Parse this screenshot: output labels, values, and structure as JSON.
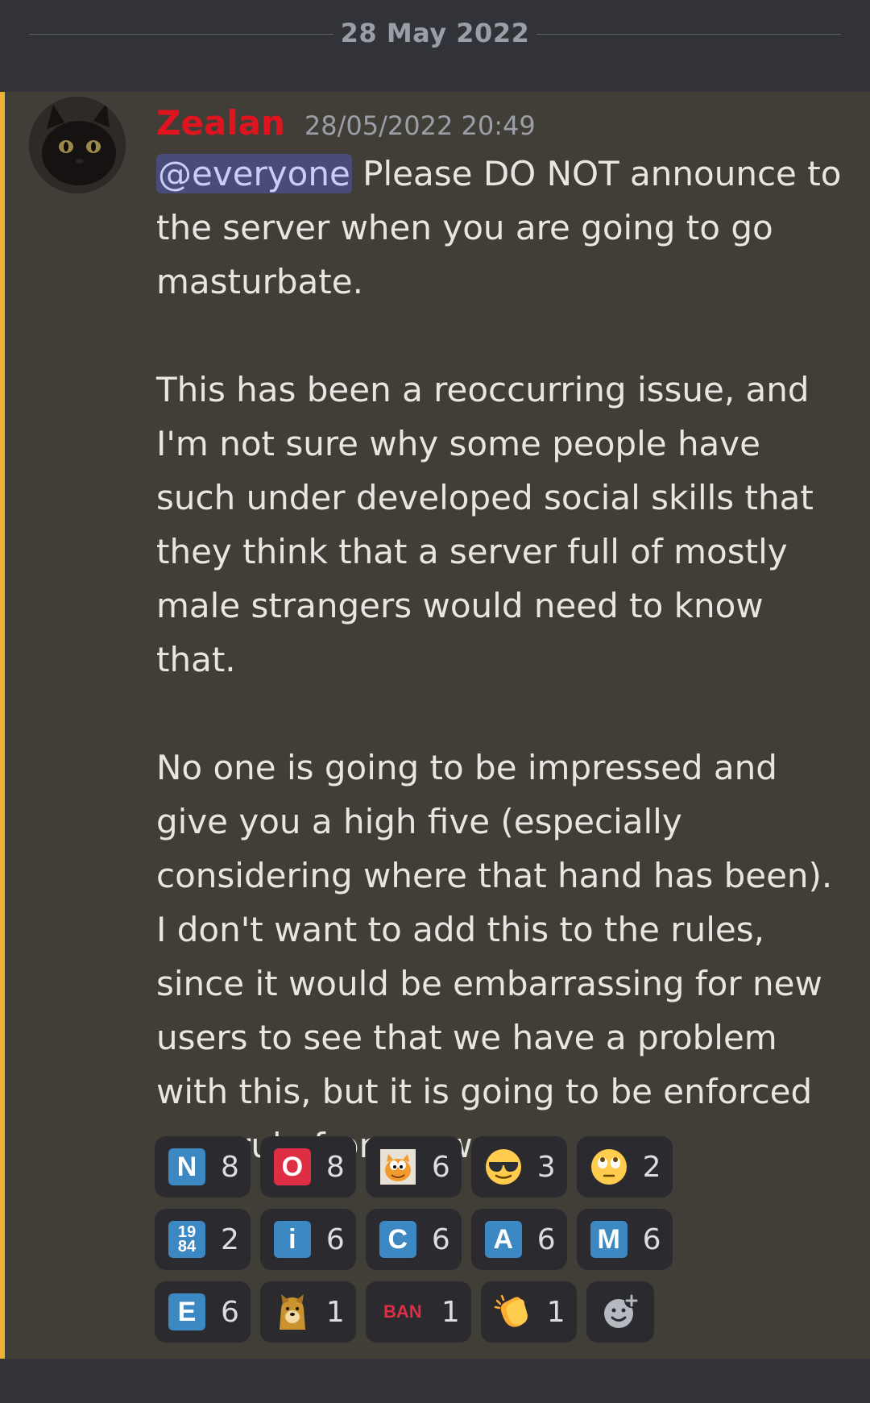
{
  "divider": {
    "date": "28 May 2022"
  },
  "message": {
    "username": "Zealan",
    "timestamp": "28/05/2022 20:49",
    "mention": "@everyone",
    "paragraph_1_rest": " Please DO NOT announce to the server when you are going to go masturbate.",
    "paragraph_2": "This has been a reoccurring issue, and I'm not sure why some people have such under developed social skills that they think that a server full of mostly male strangers would need to know that.",
    "paragraph_3": "No one is going to be impressed and give you a high five (especially considering where that hand has been). I don't want to add this to the rules, since it would be embarrassing for new users to see that we have a problem with this, but it is going to be enforced as a rule from now on."
  },
  "reactions": {
    "row1": [
      {
        "icon": "regional-indicator-n",
        "label": "N",
        "count": "8"
      },
      {
        "icon": "letter-o-red",
        "label": "O",
        "count": "8"
      },
      {
        "icon": "garfield-emoji",
        "count": "6"
      },
      {
        "icon": "sunglasses-emoji",
        "count": "3"
      },
      {
        "icon": "eye-roll-emoji",
        "count": "2"
      }
    ],
    "row2": [
      {
        "icon": "number-1984-tile",
        "label_top": "19",
        "label_bottom": "84",
        "count": "2"
      },
      {
        "icon": "regional-indicator-i",
        "label": "i",
        "count": "6"
      },
      {
        "icon": "regional-indicator-c",
        "label": "C",
        "count": "6"
      },
      {
        "icon": "regional-indicator-a",
        "label": "A",
        "count": "6"
      },
      {
        "icon": "regional-indicator-m",
        "label": "M",
        "count": "6"
      }
    ],
    "row3": [
      {
        "icon": "regional-indicator-e",
        "label": "E",
        "count": "6"
      },
      {
        "icon": "doge-emoji",
        "count": "1"
      },
      {
        "icon": "ban-emoji",
        "label": "BAN",
        "count": "1"
      },
      {
        "icon": "clapping-hands-emoji",
        "count": "1"
      },
      {
        "icon": "add-reaction-icon"
      }
    ]
  }
}
